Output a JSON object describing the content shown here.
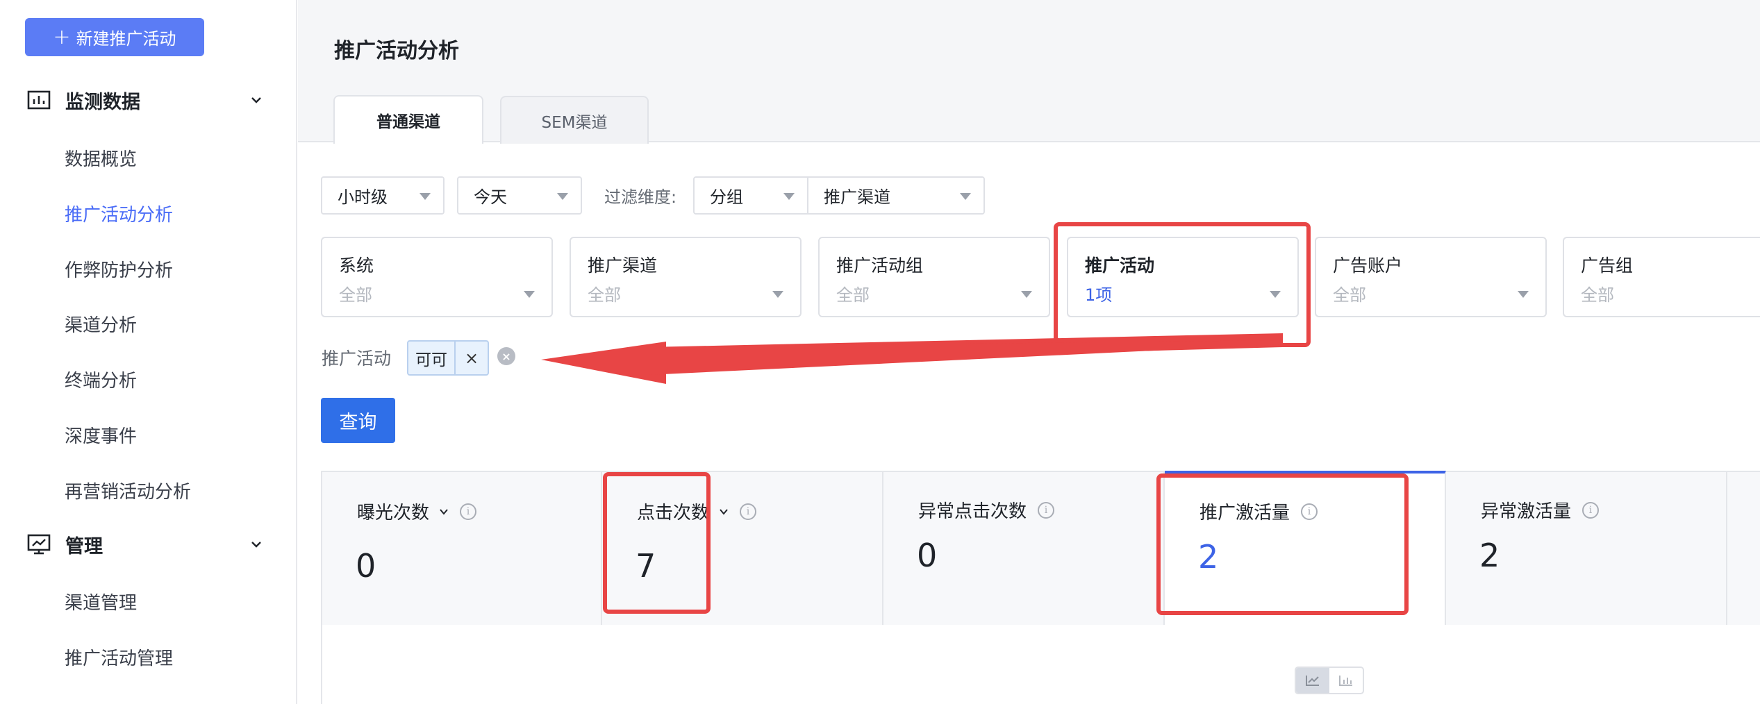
{
  "sidebar": {
    "new_button": "新建推广活动",
    "sections": [
      {
        "label": "监测数据",
        "items": [
          "数据概览",
          "推广活动分析",
          "作弊防护分析",
          "渠道分析",
          "终端分析",
          "深度事件",
          "再营销活动分析"
        ]
      },
      {
        "label": "管理",
        "items": [
          "渠道管理",
          "推广活动管理"
        ]
      }
    ],
    "active_item": "推广活动分析"
  },
  "header": {
    "title": "推广活动分析",
    "tabs": [
      {
        "label": "普通渠道",
        "active": true
      },
      {
        "label": "SEM渠道",
        "active": false
      }
    ]
  },
  "filters": {
    "granularity": "小时级",
    "date": "今天",
    "dimension_label": "过滤维度:",
    "group": "分组",
    "channel": "推广渠道"
  },
  "cards": [
    {
      "title": "系统",
      "value": "全部"
    },
    {
      "title": "推广渠道",
      "value": "全部"
    },
    {
      "title": "推广活动组",
      "value": "全部"
    },
    {
      "title": "推广活动",
      "value": "1项"
    },
    {
      "title": "广告账户",
      "value": "全部"
    },
    {
      "title": "广告组",
      "value": "全部"
    }
  ],
  "selected": {
    "label": "推广活动",
    "tag": "可可",
    "remove": "×",
    "clear": "×"
  },
  "query_button": "查询",
  "metrics": [
    {
      "label": "曝光次数",
      "value": "0"
    },
    {
      "label": "点击次数",
      "value": "7"
    },
    {
      "label": "异常点击次数",
      "value": "0"
    },
    {
      "label": "推广激活量",
      "value": "2"
    },
    {
      "label": "异常激活量",
      "value": "2"
    }
  ],
  "colors": {
    "accent": "#4a6cf7",
    "primary_button": "#2f6fe8",
    "highlight_red": "#e84545"
  }
}
